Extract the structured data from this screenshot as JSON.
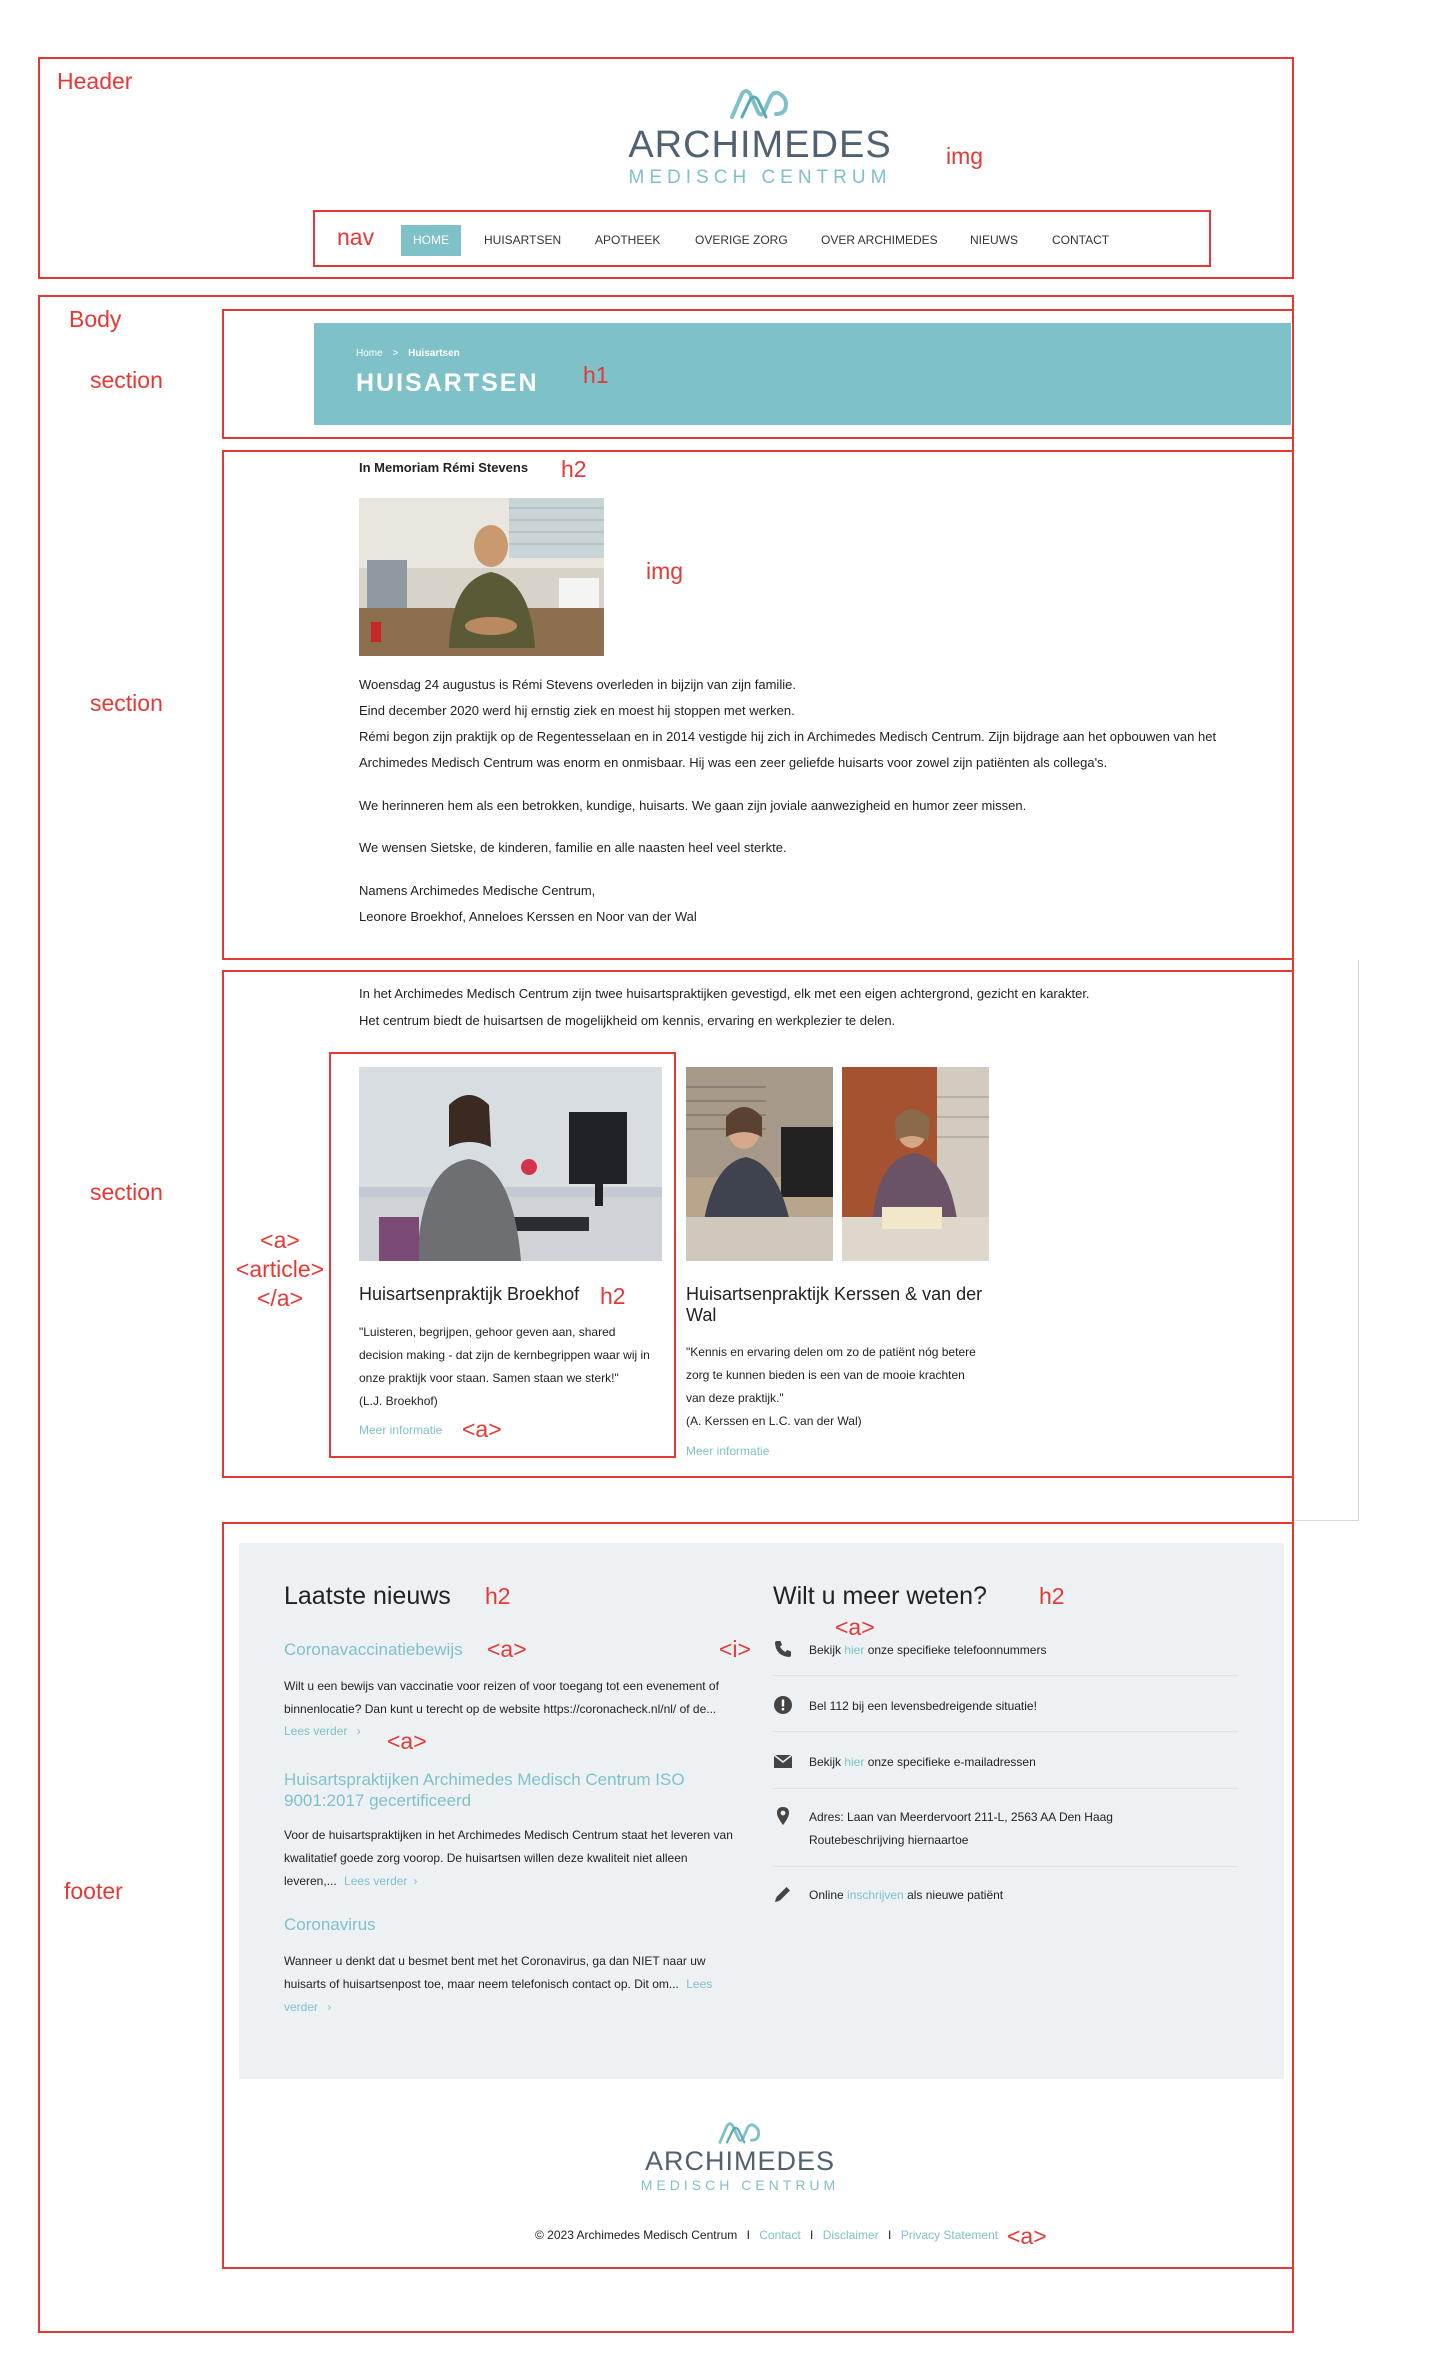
{
  "annotations": {
    "header": "Header",
    "img_logo": "img",
    "nav": "nav",
    "body": "Body",
    "section1": "section",
    "h1": "h1",
    "section2": "section",
    "h2_memoriam": "h2",
    "img_photo": "img",
    "section3": "section",
    "a_article": [
      "<a>",
      "<article>",
      "</a>"
    ],
    "h2_broekhof": "h2",
    "a_meer": "<a>",
    "footer": "footer",
    "h2_nieuws": "h2",
    "a_news1": "<a>",
    "i_icon": "<i>",
    "a_hier": "<a>",
    "a_lees1": "<a>",
    "h2_meer": "h2",
    "a_footer": "<a>"
  },
  "logo": {
    "name": "ARCHIMEDES",
    "sub": "MEDISCH CENTRUM",
    "colors": {
      "mark": "#7fc1c9",
      "name": "#4f6273",
      "sub": "#7fc1c9"
    }
  },
  "nav": {
    "items": [
      "HOME",
      "HUISARTSEN",
      "APOTHEEK",
      "OVERIGE ZORG",
      "OVER ARCHIMEDES",
      "NIEUWS",
      "CONTACT"
    ],
    "active_color": "#7fc1c9"
  },
  "banner": {
    "breadcrumb_home": "Home",
    "breadcrumb_sep": ">",
    "breadcrumb_current": "Huisartsen",
    "title": "HUISARTSEN",
    "color": "#7fc1c9"
  },
  "memoriam": {
    "title": "In Memoriam Rémi Stevens",
    "lines": [
      "Woensdag 24 augustus is Rémi Stevens overleden in bijzijn van zijn familie.",
      "Eind december 2020 werd hij ernstig ziek en moest hij stoppen met werken.",
      "Rémi begon zijn praktijk op de Regentesselaan en in 2014 vestigde hij zich in Archimedes Medisch Centrum. Zijn bijdrage aan het opbouwen van het",
      "Archimedes Medisch Centrum was enorm en onmisbaar. Hij was een zeer geliefde huisarts voor zowel zijn patiënten als collega's."
    ],
    "p2": "We herinneren hem als een betrokken, kundige, huisarts. We gaan zijn joviale aanwezigheid en humor zeer missen.",
    "p3": "We wensen Sietske, de kinderen, familie en alle naasten heel veel sterkte.",
    "sign1": "Namens Archimedes Medische Centrum,",
    "sign2": "Leonore Broekhof, Anneloes Kerssen en Noor van der Wal"
  },
  "practices": {
    "intro1": "In het Archimedes Medisch Centrum zijn twee huisartspraktijken gevestigd, elk met een eigen achtergrond, gezicht en karakter.",
    "intro2": "Het centrum biedt de huisartsen de mogelijkheid om kennis, ervaring en werkplezier te delen.",
    "items": [
      {
        "title": "Huisartsenpraktijk Broekhof",
        "quote": [
          "\"Luisteren, begrijpen, gehoor geven aan, shared",
          "decision making - dat zijn de kernbegrippen waar wij in",
          "onze praktijk voor staan. Samen staan we sterk!\""
        ],
        "author": "(L.J. Broekhof)",
        "link": "Meer informatie"
      },
      {
        "title": [
          "Huisartsenpraktijk Kerssen & van der",
          "Wal"
        ],
        "quote": [
          "\"Kennis en ervaring delen om zo de patiënt nóg betere",
          "zorg te kunnen bieden is een van de mooie krachten",
          "van deze praktijk.\""
        ],
        "author": "(A. Kerssen en L.C. van der Wal)",
        "link": "Meer informatie"
      }
    ]
  },
  "news": {
    "heading": "Laatste nieuws",
    "items": [
      {
        "title": "Coronavaccinatiebewijs",
        "body": [
          "Wilt u een bewijs van vaccinatie voor reizen of voor toegang tot een evenement of",
          "binnenlocatie? Dan kunt u terecht op de website https://coronacheck.nl/nl/ of de..."
        ],
        "more": "Lees verder"
      },
      {
        "title": [
          "Huisartspraktijken Archimedes Medisch Centrum ISO",
          "9001:2017 gecertificeerd"
        ],
        "body": [
          "Voor de huisartspraktijken in het Archimedes Medisch Centrum staat het leveren van",
          "kwalitatief goede zorg voorop. De huisartsen willen deze kwaliteit niet alleen",
          "leveren,..."
        ],
        "more": "Lees verder"
      },
      {
        "title": "Coronavirus",
        "body": [
          "Wanneer u denkt dat u besmet bent met het Coronavirus, ga dan NIET naar uw",
          "huisarts of huisartsenpost toe, maar neem telefonisch contact op. Dit om..."
        ],
        "more_a": "Lees",
        "more_b": "verder"
      }
    ]
  },
  "info": {
    "heading": "Wilt u meer weten?",
    "phone": {
      "pre": "Bekijk ",
      "link": "hier",
      "post": " onze specifieke telefoonnummers",
      "icon": "phone-icon"
    },
    "emergency": {
      "text": "Bel 112 bij een levensbedreigende situatie!",
      "icon": "alert-icon"
    },
    "mail": {
      "pre": "Bekijk ",
      "link": "hier",
      "post": " onze specifieke e-mailadressen",
      "icon": "envelope-icon"
    },
    "address": {
      "text": "Adres: Laan van Meerdervoort 211-L, 2563 AA Den Haag",
      "link": "Routebeschrijving hiernaartoe",
      "icon": "map-pin-icon"
    },
    "register": {
      "pre": "Online ",
      "link": "inschrijven",
      "post": " als nieuwe patiënt",
      "icon": "pencil-icon"
    }
  },
  "footer": {
    "copyright": "© 2023 Archimedes Medisch Centrum",
    "sep": "I",
    "links": [
      "Contact",
      "Disclaimer",
      "Privacy Statement"
    ],
    "bg_color": "#eef1f3"
  }
}
